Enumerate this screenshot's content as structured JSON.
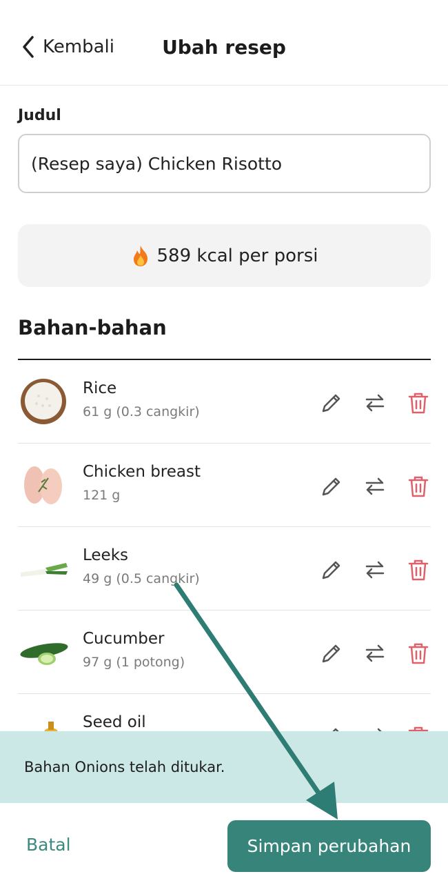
{
  "header": {
    "back_label": "Kembali",
    "title": "Ubah resep"
  },
  "form": {
    "title_label": "Judul",
    "title_value": "(Resep saya) Chicken Risotto",
    "kcal_text": "589 kcal per porsi"
  },
  "ingredients": {
    "heading": "Bahan-bahan",
    "items": [
      {
        "name": "Rice",
        "amount": "61 g (0.3 cangkir)"
      },
      {
        "name": "Chicken breast",
        "amount": "121 g"
      },
      {
        "name": "Leeks",
        "amount": "49 g (0.5 cangkir)"
      },
      {
        "name": "Cucumber",
        "amount": "97 g (1 potong)"
      },
      {
        "name": "Seed oil",
        "amount": ""
      }
    ]
  },
  "toast": {
    "message": "Bahan Onions telah ditukar."
  },
  "footer": {
    "cancel_label": "Batal",
    "save_label": "Simpan perubahan"
  },
  "colors": {
    "accent": "#37847a",
    "toast_bg": "#cce8e6",
    "delete": "#e0606a",
    "annotation_arrow": "#2e7d74"
  }
}
